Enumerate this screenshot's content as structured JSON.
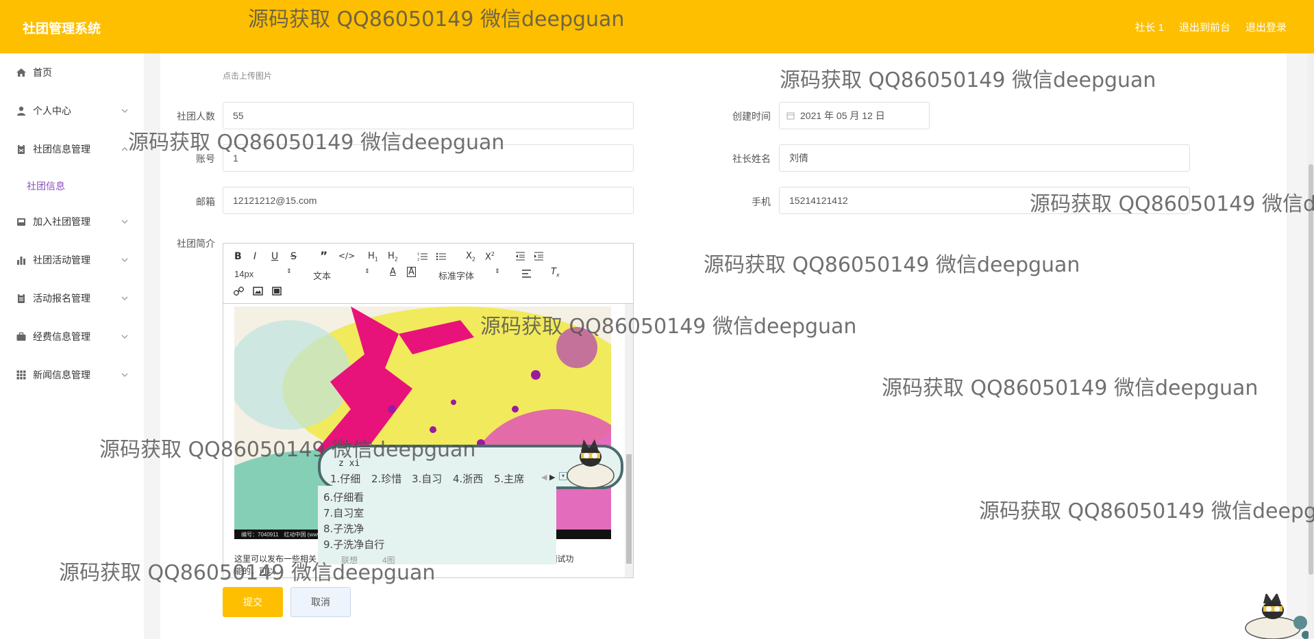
{
  "header": {
    "app_title": "社团管理系统",
    "user": "社长 1",
    "front_link": "退出到前台",
    "logout": "退出登录"
  },
  "sidebar": {
    "items": [
      {
        "label": "首页",
        "icon": "home-icon"
      },
      {
        "label": "个人中心",
        "icon": "user-icon"
      },
      {
        "label": "社团信息管理",
        "icon": "clipboard-icon"
      },
      {
        "label": "加入社团管理",
        "icon": "inbox-icon"
      },
      {
        "label": "社团活动管理",
        "icon": "chart-icon"
      },
      {
        "label": "活动报名管理",
        "icon": "clipboard-icon"
      },
      {
        "label": "经费信息管理",
        "icon": "briefcase-icon"
      },
      {
        "label": "新闻信息管理",
        "icon": "grid-icon"
      }
    ],
    "submenu": {
      "label": "社团信息"
    }
  },
  "form": {
    "upload_hint": "点击上传图片",
    "members_label": "社团人数",
    "members_value": "55",
    "created_label": "创建时间",
    "created_value": "2021 年 05 月 12 日",
    "account_label": "账号",
    "account_value": "1",
    "leader_label": "社长姓名",
    "leader_value": "刘倩",
    "email_label": "邮箱",
    "email_value": "12121212@15.com",
    "phone_label": "手机",
    "phone_value": "15214121412",
    "intro_label": "社团简介"
  },
  "editor": {
    "font_size": "14px",
    "block_type": "文本",
    "font_family": "标准字体",
    "image_caption": "编号：7040911　红动中国 (www...",
    "text_left": "这里可以发布一些相关",
    "text_right": "是用于测试功",
    "text_line2": "能的，可以"
  },
  "buttons": {
    "submit": "提交",
    "cancel": "取消"
  },
  "ime": {
    "composition": "z xi",
    "candidates": [
      "1.仔细",
      "2.珍惜",
      "3.自习",
      "4.浙西",
      "5.主席",
      "6.仔细看",
      "7.自习室",
      "8.子洗净",
      "9.子洗净自行"
    ],
    "footer_left": "联想",
    "footer_right": "4图"
  },
  "watermark": "源码获取 QQ86050149 微信deepguan",
  "colors": {
    "header": "#fdbf00",
    "accent": "#fdbf00",
    "submenu": "#8a4dbe"
  }
}
